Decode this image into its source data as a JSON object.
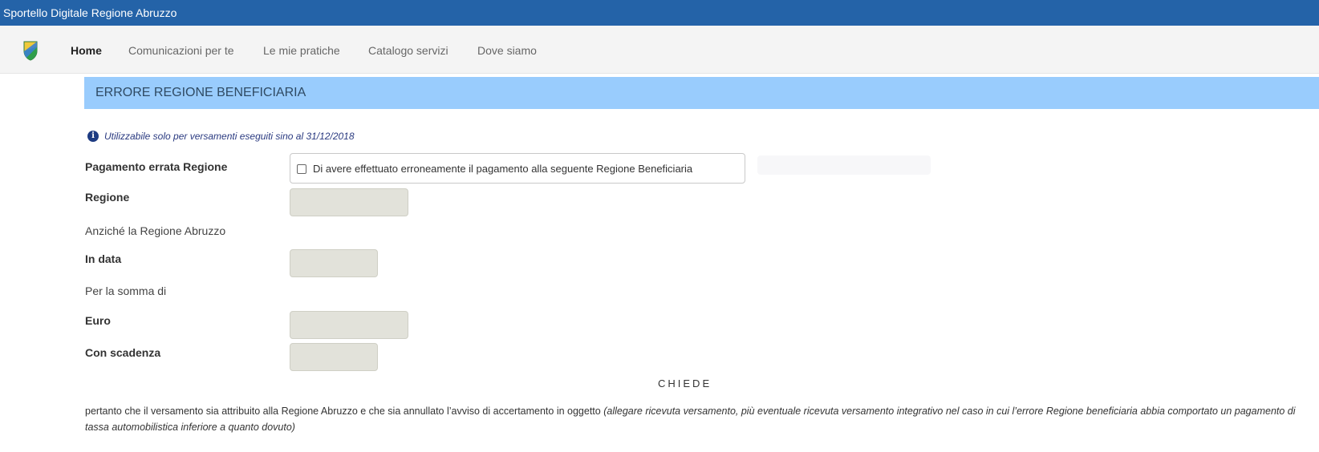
{
  "app": {
    "title": "Sportello Digitale Regione Abruzzo"
  },
  "nav": {
    "items": [
      {
        "label": "Home",
        "active": true
      },
      {
        "label": "Comunicazioni per te",
        "active": false
      },
      {
        "label": "Le mie pratiche",
        "active": false
      },
      {
        "label": "Catalogo servizi",
        "active": false
      },
      {
        "label": "Dove siamo",
        "active": false
      }
    ]
  },
  "section": {
    "title": "ERRORE REGIONE BENEFICIARIA"
  },
  "note": {
    "icon": "info-icon",
    "text": "Utilizzabile solo per versamenti eseguiti sino al 31/12/2018"
  },
  "form": {
    "pagamento_label": "Pagamento errata Regione",
    "checkbox_label": "Di avere effettuato erroneamente il pagamento alla seguente Regione Beneficiaria",
    "checkbox_checked": false,
    "regione_label": "Regione",
    "regione_value": "",
    "anziche_text": "Anziché la Regione Abruzzo",
    "data_label": "In data",
    "data_value": "",
    "somma_text": "Per la somma di",
    "euro_label": "Euro",
    "euro_value": "",
    "scadenza_label": "Con scadenza",
    "scadenza_value": ""
  },
  "request": {
    "heading": "CHIEDE",
    "text": "pertanto che il versamento sia attribuito alla Regione Abruzzo e che sia annullato l’avviso di accertamento in oggetto",
    "note": "(allegare ricevuta versamento, più eventuale ricevuta versamento integrativo nel caso in cui l’errore Regione beneficiaria abbia comportato un pagamento di tassa automobilistica inferiore a quanto dovuto)"
  },
  "colors": {
    "topbar": "#2463a8",
    "section_header": "#99ccfd",
    "field_bg": "#e2e2da"
  }
}
